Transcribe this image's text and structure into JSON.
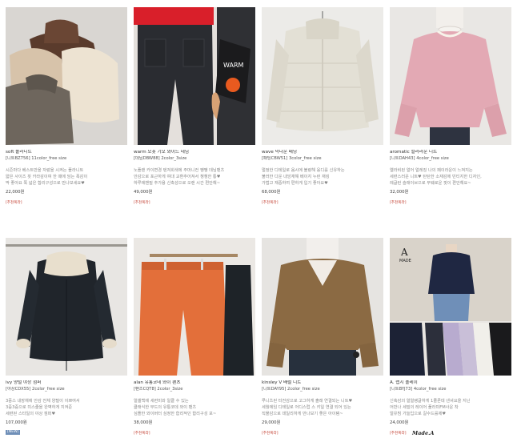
{
  "products": [
    {
      "name": "soft 폴라니트",
      "options": "[니트BZ756] 11color_free size",
      "description": [
        "시즌마다 베스트만을 자랑을 시켜는 폴라니트",
        "얇은 사이즈 핏 카라감이여 한 때에 담는 폭감이",
        "딱 좋아요 쭉 넓은 합리구성으로 만나보세요♥"
      ],
      "price": "22,000원",
      "badge": "[추천폭라]"
    },
    {
      "name": "warm 모폿 기모 와이드 데님",
      "options": "[데님DBW88] 2color_3size",
      "description": [
        "노플랜 카이변경 텐져회색에 주머니컨 쨍쨍 데님팬츠",
        "안감으로 포근하게 여대 교환추어져서 챙챙한 통♥",
        "하루에밴질 추가용 신축성으로 오랜 시간 편안해~"
      ],
      "price": "49,000원",
      "badge": "[추천폭라]"
    },
    {
      "name": "wave 덕다운 패딩",
      "options": "[패딩CBW51] 3color_free size",
      "description": [
        "멀정한 디테일로 옴시에 불량해 웅디를 신유하는",
        "불러한 다운 내앙재해 베이지 누런 재킹",
        "가법고 재중하여 편하게 입기 좋아요♥"
      ],
      "price": "68,000원",
      "badge": "[추천폭라]"
    },
    {
      "name": "aromatic 컬러라운 니트",
      "options": "[니트DAH43] 4color_free size",
      "description": [
        "엘라비된 얼어 얼레징 나의 페이라운이 느껴지는",
        "세련스러운 니트♥ 탄탄한 소재감에 빈티지한 디자인,",
        "레글런 슬래이브으로 부웨로운 핏이 편안해요~"
      ],
      "price": "32,000원",
      "badge": "[추천폭라]"
    },
    {
      "name": "ivy 양털 야상 점퍼",
      "options": "[야상CDX55] 2color_free size",
      "description": [
        "3중스 내장채에 안감 전체 양털이 이쁘여서",
        "3중3중으로 미스줄을 완벽하게 지켜준",
        "세련된 스타일의 야상 점퍼♥"
      ],
      "price": "107,000원",
      "badge": "[NEW]"
    },
    {
      "name": "alan 유통코데 와이 팬츠",
      "options": "[팬츠CQT8] 2color_3size",
      "description": [
        "얼셀백에 세련미와 일클 수 있는",
        "클래식한 무드의 유통코데 와이 팬츠",
        "심플한 와이버터 심정한 합리적인 합리구성 포~"
      ],
      "price": "38,000원",
      "badge": "[추천폭라]"
    },
    {
      "name": "kinsley V 배럴 니트",
      "options": "[니트DAY95] 2color_free size",
      "description": [
        "루니츠된 터전감으로 고그하게 출래 연결되는 니트♥",
        "세월에임 디테일로 어디스럽 스 키일 연결 되어 있는",
        "직물감으로 데일리하게 만나보기 좋은 아이템~"
      ],
      "price": "29,000원",
      "badge": "[추천폭라]"
    },
    {
      "name": "A. 랩지 폴레이",
      "options": "[니트BYJ73] 4color_free size",
      "description": [
        "신축감의 얼얼랭글하게 1줄론데 넨셔요을 지닌",
        "어반나 세밀의 레이어 풀라미FM사운 착",
        "얼유빔 가늘입으로 갈수드를제♥"
      ],
      "price": "24,000원",
      "badge": "[추천폭라]",
      "brand_mark": "Made.A",
      "photo_label_top": "A",
      "photo_label_bottom": "MADE"
    }
  ],
  "colors": {
    "badge_red": "#c0392b",
    "new_badge_bg": "#6f8fb8",
    "text_dark": "#333333",
    "text_muted": "#888888"
  }
}
